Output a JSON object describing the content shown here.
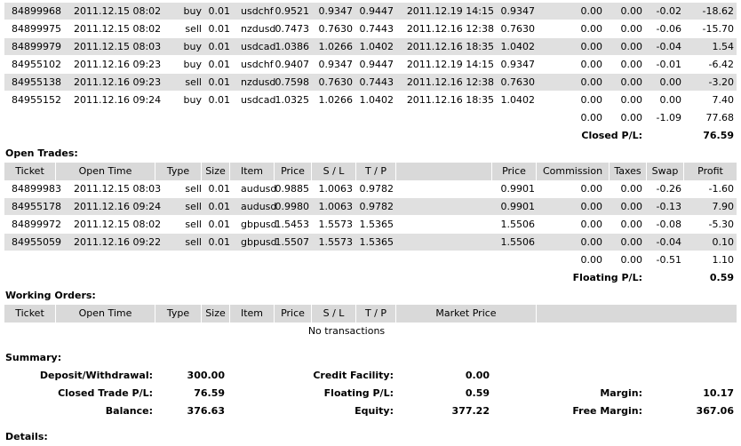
{
  "closed_rows": [
    {
      "ticket": "84899968",
      "open_time": "2011.12.15 08:02",
      "type": "buy",
      "size": "0.01",
      "item": "usdchf",
      "price": "0.9521",
      "sl": "0.9347",
      "tp": "0.9447",
      "close_time": "2011.12.19 14:15",
      "close_price": "0.9347",
      "commission": "0.00",
      "taxes": "0.00",
      "swap": "-0.02",
      "profit": "-18.62",
      "band": true
    },
    {
      "ticket": "84899975",
      "open_time": "2011.12.15 08:02",
      "type": "sell",
      "size": "0.01",
      "item": "nzdusd",
      "price": "0.7473",
      "sl": "0.7630",
      "tp": "0.7443",
      "close_time": "2011.12.16 12:38",
      "close_price": "0.7630",
      "commission": "0.00",
      "taxes": "0.00",
      "swap": "-0.06",
      "profit": "-15.70",
      "band": false
    },
    {
      "ticket": "84899979",
      "open_time": "2011.12.15 08:03",
      "type": "buy",
      "size": "0.01",
      "item": "usdcad",
      "price": "1.0386",
      "sl": "1.0266",
      "tp": "1.0402",
      "close_time": "2011.12.16 18:35",
      "close_price": "1.0402",
      "commission": "0.00",
      "taxes": "0.00",
      "swap": "-0.04",
      "profit": "1.54",
      "band": true
    },
    {
      "ticket": "84955102",
      "open_time": "2011.12.16 09:23",
      "type": "buy",
      "size": "0.01",
      "item": "usdchf",
      "price": "0.9407",
      "sl": "0.9347",
      "tp": "0.9447",
      "close_time": "2011.12.19 14:15",
      "close_price": "0.9347",
      "commission": "0.00",
      "taxes": "0.00",
      "swap": "-0.01",
      "profit": "-6.42",
      "band": false
    },
    {
      "ticket": "84955138",
      "open_time": "2011.12.16 09:23",
      "type": "sell",
      "size": "0.01",
      "item": "nzdusd",
      "price": "0.7598",
      "sl": "0.7630",
      "tp": "0.7443",
      "close_time": "2011.12.16 12:38",
      "close_price": "0.7630",
      "commission": "0.00",
      "taxes": "0.00",
      "swap": "0.00",
      "profit": "-3.20",
      "band": true
    },
    {
      "ticket": "84955152",
      "open_time": "2011.12.16 09:24",
      "type": "buy",
      "size": "0.01",
      "item": "usdcad",
      "price": "1.0325",
      "sl": "1.0266",
      "tp": "1.0402",
      "close_time": "2011.12.16 18:35",
      "close_price": "1.0402",
      "commission": "0.00",
      "taxes": "0.00",
      "swap": "0.00",
      "profit": "7.40",
      "band": false
    }
  ],
  "closed_totals": {
    "commission": "0.00",
    "taxes": "0.00",
    "swap": "-1.09",
    "profit": "77.68"
  },
  "closed_pl": {
    "label": "Closed P/L:",
    "value": "76.59"
  },
  "open_title": "Open Trades:",
  "headers": {
    "ticket": "Ticket",
    "open_time": "Open Time",
    "type": "Type",
    "size": "Size",
    "item": "Item",
    "price": "Price",
    "sl": "S / L",
    "tp": "T / P",
    "price2": "Price",
    "commission": "Commission",
    "taxes": "Taxes",
    "swap": "Swap",
    "profit": "Profit",
    "market_price": "Market Price"
  },
  "open_rows": [
    {
      "ticket": "84899983",
      "open_time": "2011.12.15 08:03",
      "type": "sell",
      "size": "0.01",
      "item": "audusd",
      "price": "0.9885",
      "sl": "1.0063",
      "tp": "0.9782",
      "cur_price": "0.9901",
      "commission": "0.00",
      "taxes": "0.00",
      "swap": "-0.26",
      "profit": "-1.60",
      "band": false
    },
    {
      "ticket": "84955178",
      "open_time": "2011.12.16 09:24",
      "type": "sell",
      "size": "0.01",
      "item": "audusd",
      "price": "0.9980",
      "sl": "1.0063",
      "tp": "0.9782",
      "cur_price": "0.9901",
      "commission": "0.00",
      "taxes": "0.00",
      "swap": "-0.13",
      "profit": "7.90",
      "band": true
    },
    {
      "ticket": "84899972",
      "open_time": "2011.12.15 08:02",
      "type": "sell",
      "size": "0.01",
      "item": "gbpusd",
      "price": "1.5453",
      "sl": "1.5573",
      "tp": "1.5365",
      "cur_price": "1.5506",
      "commission": "0.00",
      "taxes": "0.00",
      "swap": "-0.08",
      "profit": "-5.30",
      "band": false
    },
    {
      "ticket": "84955059",
      "open_time": "2011.12.16 09:22",
      "type": "sell",
      "size": "0.01",
      "item": "gbpusd",
      "price": "1.5507",
      "sl": "1.5573",
      "tp": "1.5365",
      "cur_price": "1.5506",
      "commission": "0.00",
      "taxes": "0.00",
      "swap": "-0.04",
      "profit": "0.10",
      "band": true
    }
  ],
  "open_totals": {
    "commission": "0.00",
    "taxes": "0.00",
    "swap": "-0.51",
    "profit": "1.10"
  },
  "floating_pl": {
    "label": "Floating P/L:",
    "value": "0.59"
  },
  "working_title": "Working Orders:",
  "no_transactions": "No transactions",
  "summary_title": "Summary:",
  "summary": {
    "deposit_label": "Deposit/Withdrawal:",
    "deposit_value": "300.00",
    "credit_label": "Credit Facility:",
    "credit_value": "0.00",
    "closed_trade_label": "Closed Trade P/L:",
    "closed_trade_value": "76.59",
    "floating_label": "Floating P/L:",
    "floating_value": "0.59",
    "margin_label": "Margin:",
    "margin_value": "10.17",
    "balance_label": "Balance:",
    "balance_value": "376.63",
    "equity_label": "Equity:",
    "equity_value": "377.22",
    "free_margin_label": "Free Margin:",
    "free_margin_value": "367.06"
  },
  "details_title": "Details:",
  "colors": {
    "band": "#e0e0e0",
    "header": "#d9d9d9"
  }
}
